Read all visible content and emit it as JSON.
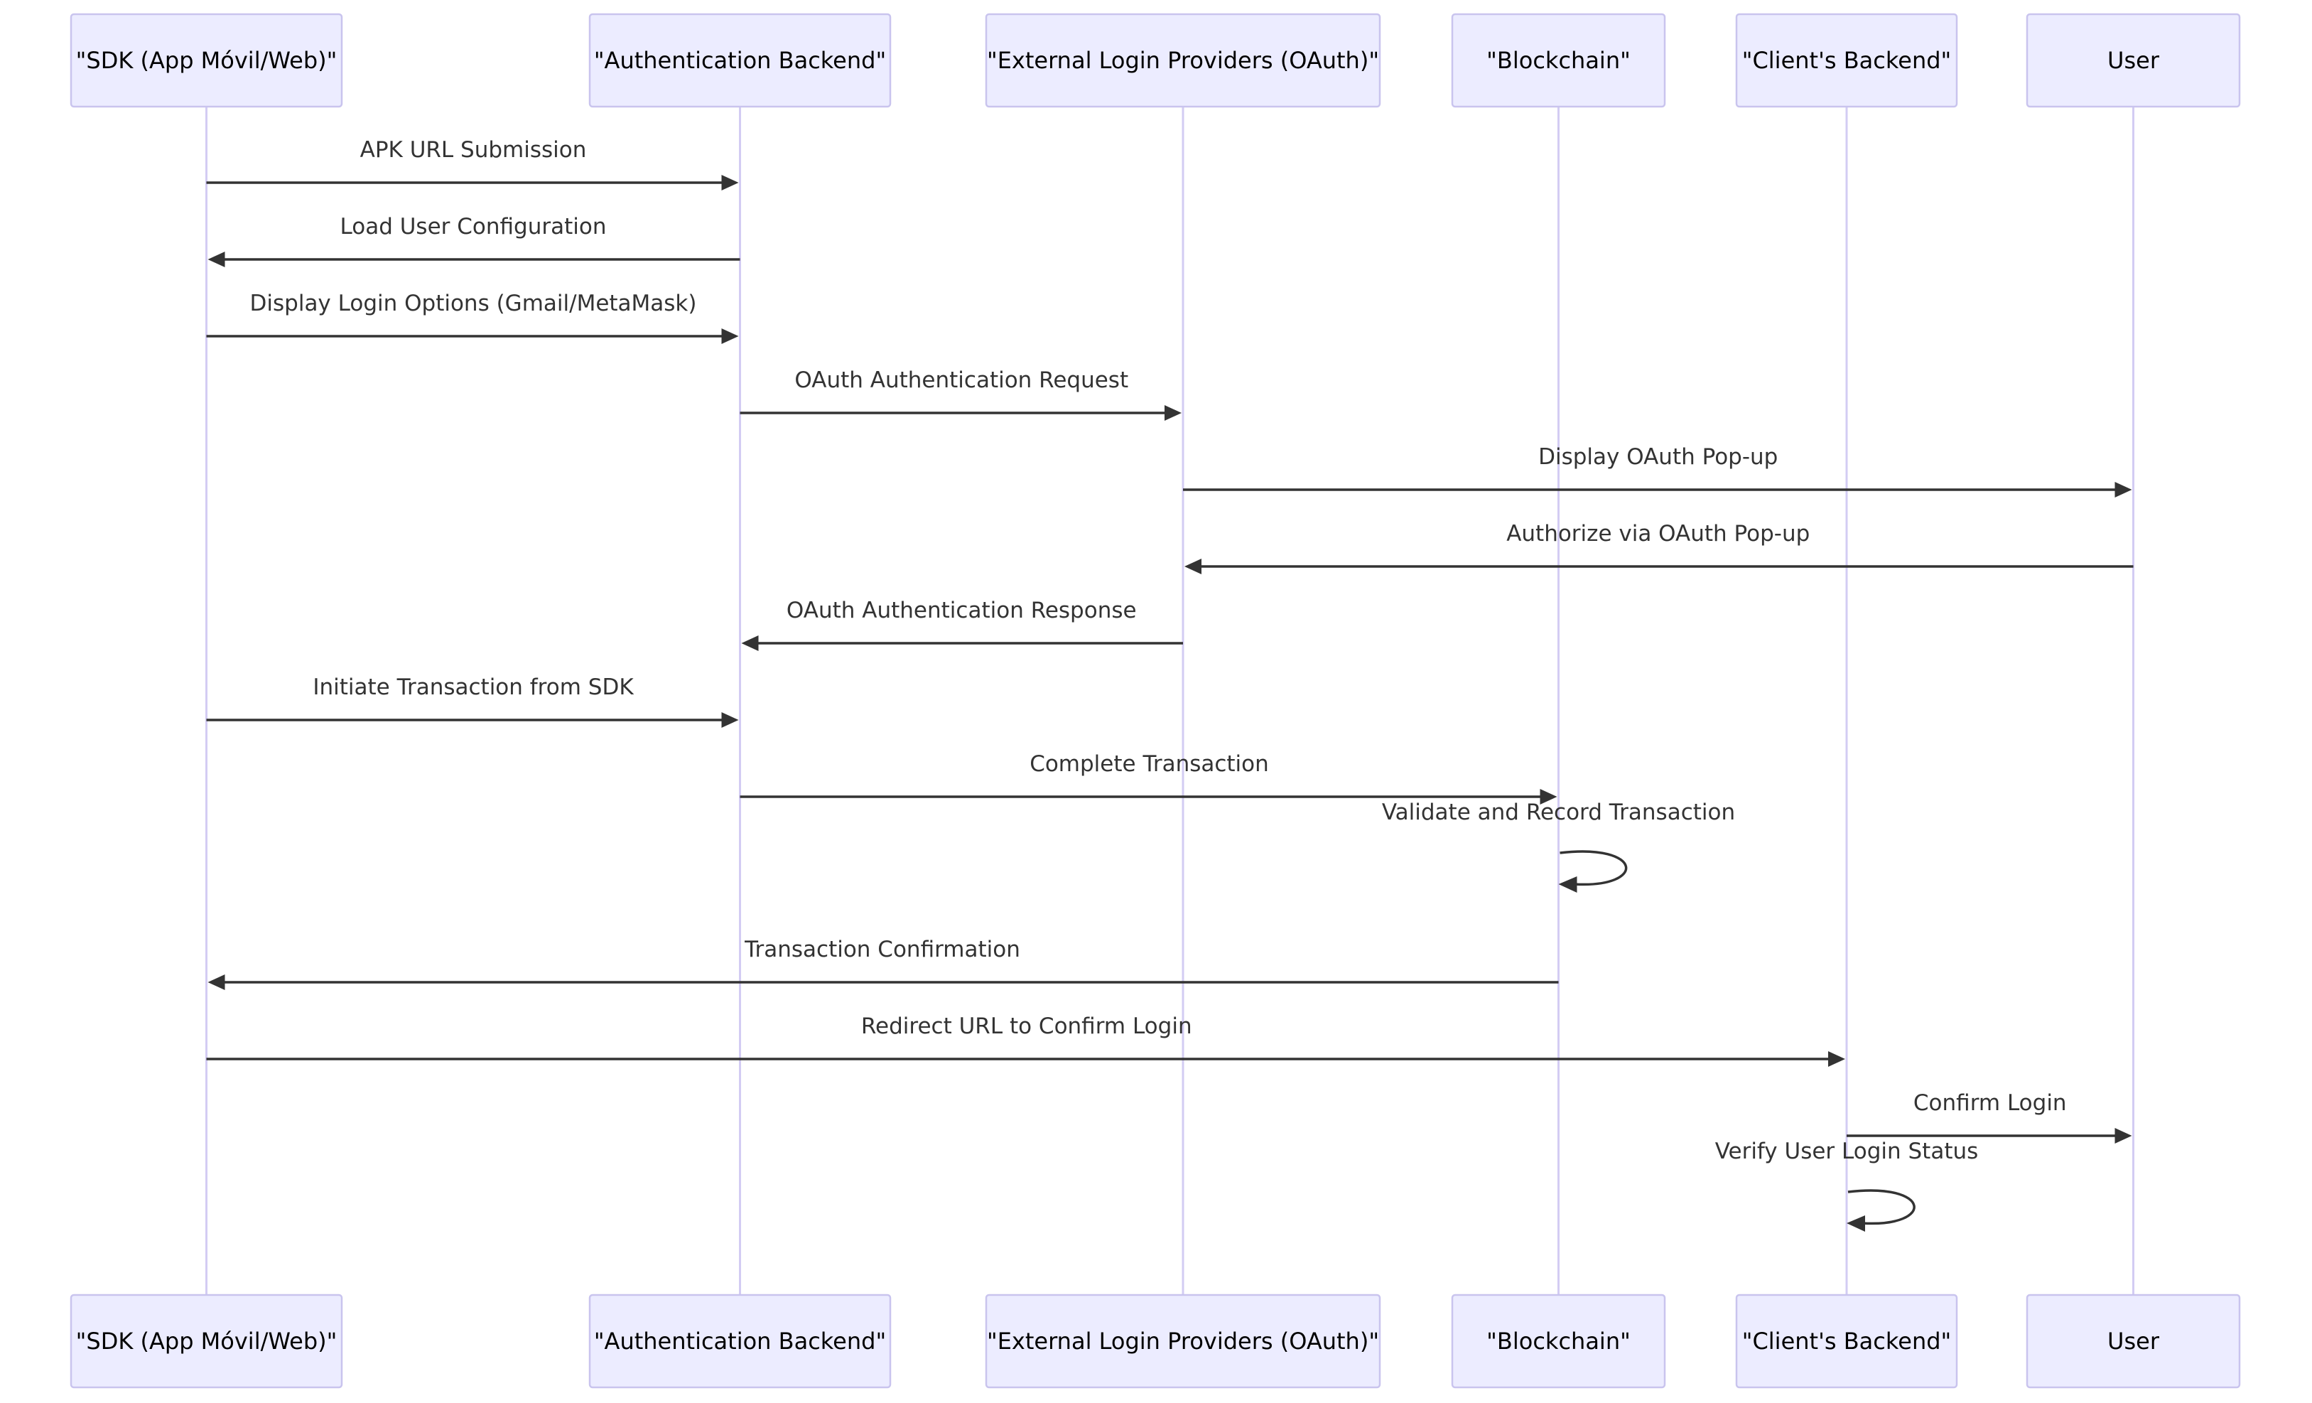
{
  "diagram": {
    "type": "sequence",
    "colors": {
      "actor_fill": "#ECECFF",
      "actor_border": "#C9C4EE",
      "lifeline": "#D3CCF3",
      "message": "#333333"
    },
    "actors": [
      {
        "id": "sdk",
        "label": "\"SDK (App Móvil/Web)\""
      },
      {
        "id": "auth",
        "label": "\"Authentication Backend\""
      },
      {
        "id": "oauth",
        "label": "\"External Login Providers (OAuth)\""
      },
      {
        "id": "chain",
        "label": "\"Blockchain\""
      },
      {
        "id": "client",
        "label": "\"Client's Backend\""
      },
      {
        "id": "user",
        "label": "User"
      }
    ],
    "messages": [
      {
        "from": "sdk",
        "to": "auth",
        "label": "APK URL Submission"
      },
      {
        "from": "auth",
        "to": "sdk",
        "label": "Load User Configuration"
      },
      {
        "from": "sdk",
        "to": "auth",
        "label": "Display Login Options (Gmail/MetaMask)"
      },
      {
        "from": "auth",
        "to": "oauth",
        "label": "OAuth Authentication Request"
      },
      {
        "from": "oauth",
        "to": "user",
        "label": "Display OAuth Pop-up"
      },
      {
        "from": "user",
        "to": "oauth",
        "label": "Authorize via OAuth Pop-up"
      },
      {
        "from": "oauth",
        "to": "auth",
        "label": "OAuth Authentication Response"
      },
      {
        "from": "sdk",
        "to": "auth",
        "label": "Initiate Transaction from SDK"
      },
      {
        "from": "auth",
        "to": "chain",
        "label": "Complete Transaction"
      },
      {
        "from": "chain",
        "to": "chain",
        "label": "Validate and Record Transaction"
      },
      {
        "from": "chain",
        "to": "sdk",
        "label": "Transaction Confirmation"
      },
      {
        "from": "sdk",
        "to": "client",
        "label": "Redirect URL to Confirm Login"
      },
      {
        "from": "client",
        "to": "user",
        "label": "Confirm Login"
      },
      {
        "from": "client",
        "to": "client",
        "label": "Verify User Login Status"
      }
    ]
  }
}
